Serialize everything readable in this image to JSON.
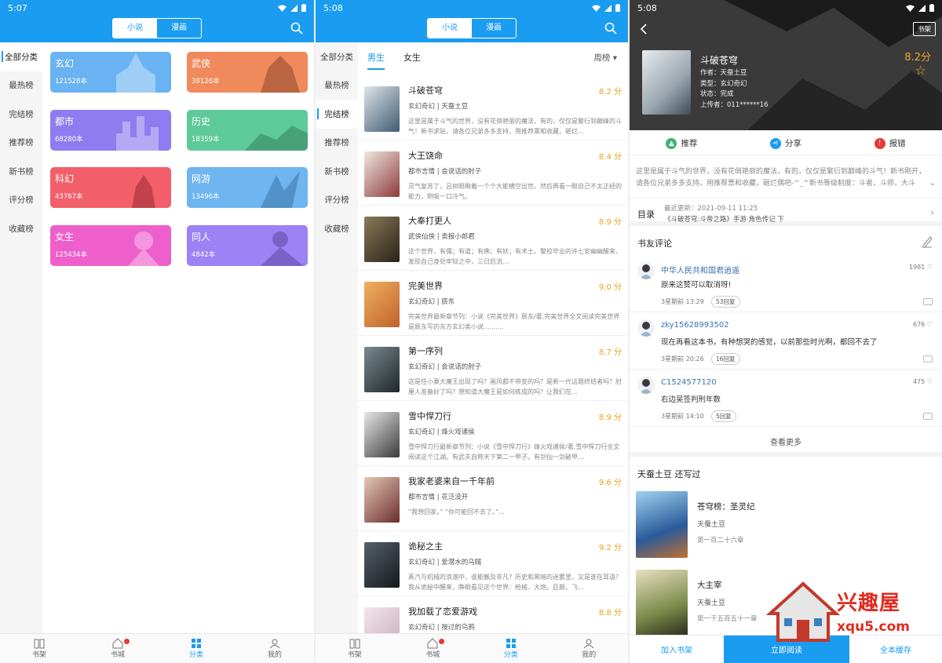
{
  "colors": {
    "accent": "#1a9cf0",
    "score": "#e8a319",
    "badge": "#e53935"
  },
  "status": {
    "s1_time": "5:07",
    "s2_time": "5:08",
    "s3_time": "5:08"
  },
  "segment": {
    "novel": "小说",
    "comic": "漫画"
  },
  "sidebar": [
    "全部分类",
    "最热榜",
    "完结榜",
    "推荐榜",
    "新书榜",
    "评分榜",
    "收藏榜"
  ],
  "categories": [
    {
      "name": "玄幻",
      "count": "121528本",
      "color": "#6ab3f2"
    },
    {
      "name": "武侠",
      "count": "38126本",
      "color": "#f08a5c"
    },
    {
      "name": "都市",
      "count": "68280本",
      "color": "#8e7cf0"
    },
    {
      "name": "历史",
      "count": "18359本",
      "color": "#5ec99a"
    },
    {
      "name": "科幻",
      "count": "43767本",
      "color": "#f25f6a"
    },
    {
      "name": "网游",
      "count": "13496本",
      "color": "#6fb5f0"
    },
    {
      "name": "女生",
      "count": "125434本",
      "color": "#ee5fcc"
    },
    {
      "name": "同人",
      "count": "4842本",
      "color": "#9b82f5"
    }
  ],
  "tabbar": {
    "shelf": "书架",
    "store": "书城",
    "category": "分类",
    "mine": "我的"
  },
  "rank": {
    "tab_male": "男生",
    "tab_female": "女生",
    "period": "周榜",
    "books": [
      {
        "title": "斗破苍穹",
        "score": "8.2 分",
        "tags": "玄幻奇幻 | 天蚕土豆",
        "desc": "这里是属于斗气的世界，没有花俏艳丽的魔法，有的，仅仅是繁衍到巅峰的斗气！新书求贴，请各位兄弟多多支持，用推荐票和收藏，砸烂...",
        "cover": "#3f5a73"
      },
      {
        "title": "大王饶命",
        "score": "8.4 分",
        "tags": "都市言情 | 会说话的肘子",
        "desc": "灵气复苏了，吕树眼瞅着一个个大能横空出世。然后再看一眼自己不太正经的能力，倒吸一口冷气。",
        "cover": "#8c3a3a"
      },
      {
        "title": "大奉打更人",
        "score": "8.9 分",
        "tags": "武侠仙侠 | 卖报小郎君",
        "desc": "这个世界，有儒；有道；有佛；有妖；有术士。警校毕业的许七安幽幽醒来，发现自己身处牢狱之中，三日后流...",
        "cover": "#4a3b2a"
      },
      {
        "title": "完美世界",
        "score": "9.0 分",
        "tags": "玄幻奇幻 | 辰东",
        "desc": "完美世界最新章节列：小说《完美世界》辰东/著,完美世界全文阅读完美世界是辰东写的东方玄幻类小说..........",
        "cover": "#c0612d"
      },
      {
        "title": "第一序列",
        "score": "8.7 分",
        "tags": "玄幻奇幻 | 会说话的肘子",
        "desc": "这是任小粟大魔王出现了吗？画风都不带变的吗？是新一代话题终结者吗？肘厘人准备好了吗？想知道大魔王是如何练成的吗？让我们在...",
        "cover": "#2f3a40"
      },
      {
        "title": "雪中悍刀行",
        "score": "8.9 分",
        "tags": "玄幻奇幻 | 烽火戏诸侯",
        "desc": "雪中悍刀行最新章节列：小说《雪中悍刀行》烽火戏诸侯/著,雪中悍刀行全文阅读这个江湖。有武夫自称天下第二一甲子。有剑仙一剑破甲...",
        "cover": "#5a5a5a"
      },
      {
        "title": "我家老婆来自一千年前",
        "score": "9.6 分",
        "tags": "都市言情 | 花泛没开",
        "desc": "“我想回家。” “你可能回不去了。”...",
        "cover": "#6a2e2a"
      },
      {
        "title": "诡秘之主",
        "score": "9.2 分",
        "tags": "玄幻奇幻 | 爱潜水的乌贼",
        "desc": "蒸汽与机械的浪潮中，谁能触及非凡？历史和黑暗的迷雾里，又是谁在耳语？我从诡秘中醒来，睁眼看见这个世界：枪械，大炮，巨舰，飞...",
        "cover": "#2a2f33"
      },
      {
        "title": "我加载了恋爱游戏",
        "score": "8.8 分",
        "tags": "玄幻奇幻 | 按过的乌鸦",
        "desc": "",
        "cover": "#c7a9b5"
      }
    ]
  },
  "detail": {
    "shelf_btn": "书架",
    "title": "斗破苍穹",
    "author": "作者：天蚕土豆",
    "type": "类型：玄幻奇幻",
    "state": "状态：完成",
    "uploader": "上传者：011******16",
    "score": "8.2分",
    "actions": {
      "recommend": "推荐",
      "share": "分享",
      "report": "报错"
    },
    "intro": "这里是属于斗气的世界，没有花俏艳丽的魔法，有的，仅仅是繁衍到巅峰的斗气！新书刚开，请各位兄弟多多支持，用推荐票和收藏，砸烂偶吧-^_^新书等级制度：斗者，斗师，大斗",
    "toc_label": "目录",
    "update": "最近更新：2021-09-11 11:25",
    "latest": "《斗破苍穹:斗帝之路》手游·角色传记 下",
    "comments_title": "书友评论",
    "comments": [
      {
        "user": "中华人民共和国君逍遥",
        "likes": "1981",
        "text": "原来这赞可以取消呀!",
        "time": "3星期前  13:29",
        "replies": "53回复"
      },
      {
        "user": "zky15628993502",
        "likes": "676",
        "text": "现在再看这本书，有种想哭的感觉，以前那些时光啊，都回不去了",
        "time": "3星期前  20:26",
        "replies": "16回复"
      },
      {
        "user": "C1524577120",
        "likes": "475",
        "text": "右边吴签判刑年数",
        "time": "3星期前  14:10",
        "replies": "5回复"
      }
    ],
    "more": "查看更多",
    "author_section": "天蚕土豆  还写过",
    "author_books": [
      {
        "title": "苍穹榜：圣灵纪",
        "author": "天蚕土豆",
        "chapter": "第一百二十六章"
      },
      {
        "title": "大主宰",
        "author": "天蚕土豆",
        "chapter": "第一千五百五十一章 "
      }
    ],
    "bottom": {
      "add": "加入书架",
      "read": "立即阅读",
      "cache": "全本缓存"
    }
  },
  "watermark": {
    "text": "兴趣屋",
    "url": "xqu5.com"
  }
}
